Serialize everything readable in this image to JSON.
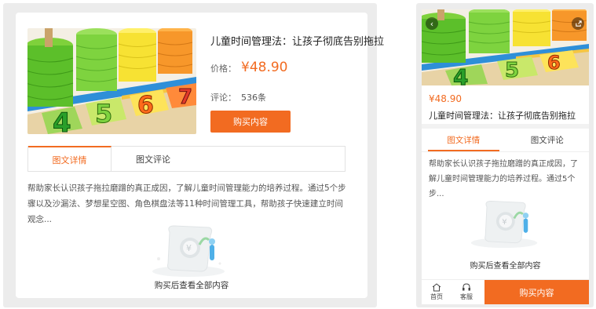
{
  "product": {
    "title": "儿童时间管理法：让孩子彻底告别拖拉",
    "price_label": "价格：",
    "price": "¥48.90",
    "review_label": "评论：",
    "review_count": "536条",
    "buy_label": "购买内容",
    "description_desktop": "帮助家长认识孩子拖拉磨蹭的真正成因，了解儿童时间管理能力的培养过程。通过5个步骤以及沙漏法、梦想星空图、角色棋盘法等11种时间管理工具，帮助孩子快速建立时间观念...",
    "description_mobile": "帮助家长认识孩子拖拉磨蹭的真正成因，了解儿童时间管理能力的培养过程。通过5个步...",
    "locked_text": "购买后查看全部内容"
  },
  "tabs": [
    {
      "label": "图文详情",
      "active": true
    },
    {
      "label": "图文评论",
      "active": false
    }
  ],
  "mobile_nav": [
    {
      "label": "首页",
      "icon": "home-icon"
    },
    {
      "label": "客服",
      "icon": "headset-icon"
    }
  ],
  "colors": {
    "accent": "#f26b21",
    "frame": "#ececec"
  }
}
